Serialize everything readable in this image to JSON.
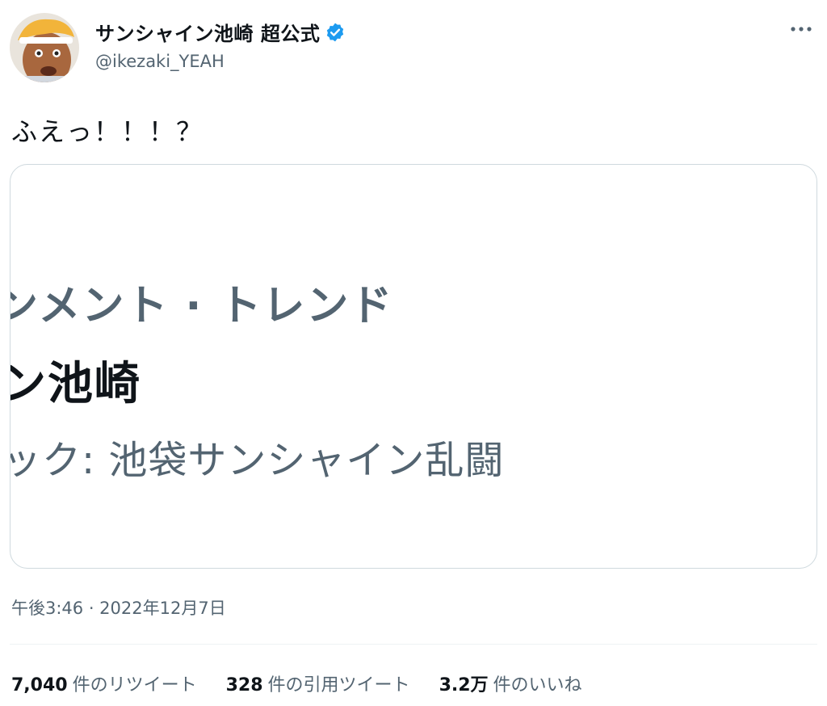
{
  "author": {
    "display_name": "サンシャイン池崎 超公式",
    "handle": "@ikezaki_YEAH",
    "verified": true,
    "avatar_icon": "user-avatar-photo",
    "verified_color": "#1d9bf0"
  },
  "tweet": {
    "text": "ふえっ！！！？",
    "timestamp": "午後3:46 · 2022年12月7日"
  },
  "media": {
    "category_line": "ンメント · トレンド",
    "name_line": "ン池崎",
    "topic_line": "ック: 池袋サンシャイン乱闘"
  },
  "stats": [
    {
      "count": "7,040",
      "label": "件のリツイート"
    },
    {
      "count": "328",
      "label": "件の引用ツイート"
    },
    {
      "count": "3.2万",
      "label": "件のいいね"
    }
  ],
  "colors": {
    "text_primary": "#0f1419",
    "text_secondary": "#536471",
    "border": "#cfd9de"
  }
}
